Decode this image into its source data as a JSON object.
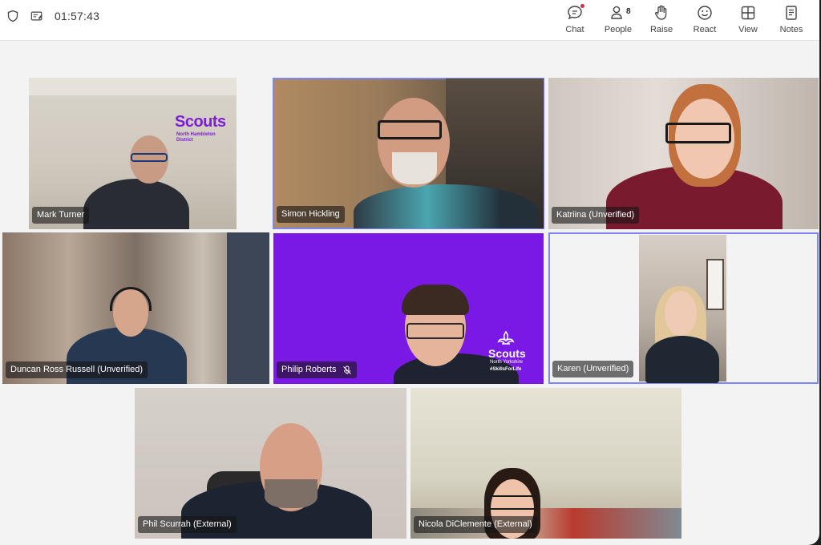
{
  "topbar": {
    "timer": "01:57:43",
    "buttons": [
      {
        "label": "Chat",
        "icon": "chat-icon"
      },
      {
        "label": "People",
        "icon": "people-icon",
        "count": "8"
      },
      {
        "label": "Raise",
        "icon": "raise-hand-icon"
      },
      {
        "label": "React",
        "icon": "react-smile-icon"
      },
      {
        "label": "View",
        "icon": "view-grid-icon"
      },
      {
        "label": "Notes",
        "icon": "notes-icon"
      }
    ]
  },
  "participants": [
    {
      "name": "Mark Turner"
    },
    {
      "name": "Simon Hickling"
    },
    {
      "name": "Katriina (Unverified)"
    },
    {
      "name": "Duncan Ross Russell (Unverified)"
    },
    {
      "name": "Philip Roberts",
      "muted": true
    },
    {
      "name": "Karen (Unverified)"
    },
    {
      "name": "Phil Scurrah (External)"
    },
    {
      "name": "Nicola DiClemente (External)"
    }
  ],
  "backgrounds": {
    "mark_turner_logo": "Scouts",
    "mark_turner_logo_sub": "North Hambleton District",
    "philip_logo": "Scouts",
    "philip_logo_sub": "North Yorkshire",
    "philip_logo_tag": "#SkillsForLife"
  },
  "colors": {
    "accent": "#7f85f5",
    "scouts_purple": "#7413dc"
  }
}
